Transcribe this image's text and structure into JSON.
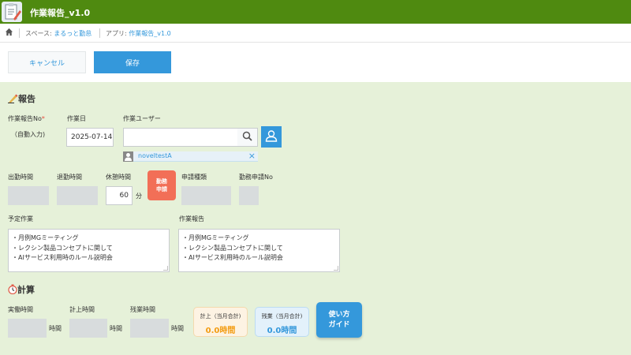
{
  "header": {
    "app_title": "作業報告_v1.0",
    "bg_color": "#4f8a10",
    "icon": "report-clipboard-icon"
  },
  "breadcrumb": {
    "home_icon": "home-icon",
    "space_prefix": "スペース: ",
    "space_name": "まるっと勤怠",
    "app_prefix": "アプリ: ",
    "app_name": "作業報告_v1.0"
  },
  "toolbar": {
    "cancel_label": "キャンセル",
    "save_label": "保存"
  },
  "report_section": {
    "title": "報告",
    "icon": "pencil-icon",
    "report_no": {
      "label": "作業報告No",
      "required_mark": "*",
      "value": "（自動入力)"
    },
    "work_date": {
      "label": "作業日",
      "value": "2025-07-14"
    },
    "work_user": {
      "label": "作業ユーザー",
      "value": "",
      "selected_user": "noveltestA",
      "search_icon": "search-icon",
      "user_icon": "user-icon",
      "remove_icon": "close-icon"
    },
    "start_time": {
      "label": "出勤時間",
      "value": ""
    },
    "end_time": {
      "label": "退勤時間",
      "value": ""
    },
    "break_time": {
      "label": "休憩時間",
      "value": "60",
      "unit": "分"
    },
    "kinmu_button": {
      "line1": "勤務",
      "line2": "申請"
    },
    "request_type": {
      "label": "申請種類",
      "value": ""
    },
    "request_no": {
      "label": "勤務申請No",
      "value": ""
    },
    "planned_work": {
      "label": "予定作業",
      "lines": [
        "・月例MGミーティング",
        "・レクシン製品コンセプトに関して",
        "・AIサービス利用時のルール説明会"
      ]
    },
    "work_report": {
      "label": "作業報告",
      "lines": [
        "・月例MGミーティング",
        "・レクシン製品コンセプトに関して",
        "・AIサービス利用時のルール説明会"
      ]
    }
  },
  "calc_section": {
    "title": "計算",
    "icon": "stopwatch-icon",
    "actual_time": {
      "label": "実働時間",
      "unit": "時間"
    },
    "recorded_time": {
      "label": "計上時間",
      "unit": "時間"
    },
    "overtime": {
      "label": "残業時間",
      "unit": "時間"
    },
    "recorded_total": {
      "title": "計上（当月合計)",
      "value": "0.0時間",
      "color": "#f39c12",
      "bg": "#fdf3e3"
    },
    "overtime_total": {
      "title": "残業（当月合計)",
      "value": "0.0時間",
      "color": "#3498db",
      "bg": "#e3f1fb"
    },
    "guide_button": {
      "line1": "使い方",
      "line2": "ガイド"
    }
  }
}
